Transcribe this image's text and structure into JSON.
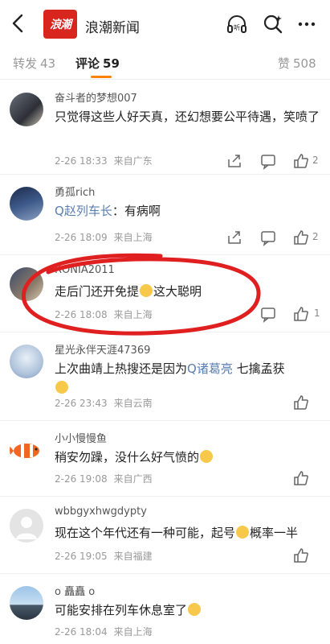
{
  "header": {
    "logo_text": "浪潮",
    "title": "浪潮新闻"
  },
  "tabs": [
    {
      "label": "转发",
      "count": "43"
    },
    {
      "label": "评论",
      "count": "59"
    },
    {
      "label": "赞",
      "count": "508"
    }
  ],
  "comments": [
    {
      "user": "奋斗者的梦想007",
      "text": "只觉得这些人好天真，还幻想要公平待遇，笑喷了",
      "time": "2-26 18:33",
      "loc": "来自广东",
      "likes": "2"
    },
    {
      "user": "勇孤rich",
      "mention": "赵列车长",
      "text": "：有病啊",
      "time": "2-26 18:09",
      "loc": "来自上海",
      "likes": "2"
    },
    {
      "user": "RONIA2011",
      "text": "走后门还开免提",
      "text_after": "这大聪明",
      "time": "2-26 18:08",
      "loc": "来自上海",
      "likes": "1"
    },
    {
      "user": "星光永伴天涯47369",
      "text": "上次曲靖上热搜还是因为",
      "mention": "诸葛亮",
      "text_after": " 七擒孟获",
      "time": "2-26 23:43",
      "loc": "来自云南"
    },
    {
      "user": "小小慢慢鱼",
      "text": "稍安勿躁，没什么好气愤的",
      "time": "2-26 19:08",
      "loc": "来自广西"
    },
    {
      "user": "wbbgyxhwgdypty",
      "text": "现在这个年代还有一种可能，起号",
      "text_after": "概率一半",
      "time": "2-26 19:05",
      "loc": "来自福建"
    },
    {
      "user": "o 矗矗 o",
      "text": "可能安排在列车休息室了",
      "time": "2-26 18:04",
      "loc": "来自上海"
    }
  ],
  "colors": {
    "accent": "#ff8200",
    "link": "#5b7fb0",
    "annotation": "#e02020"
  }
}
